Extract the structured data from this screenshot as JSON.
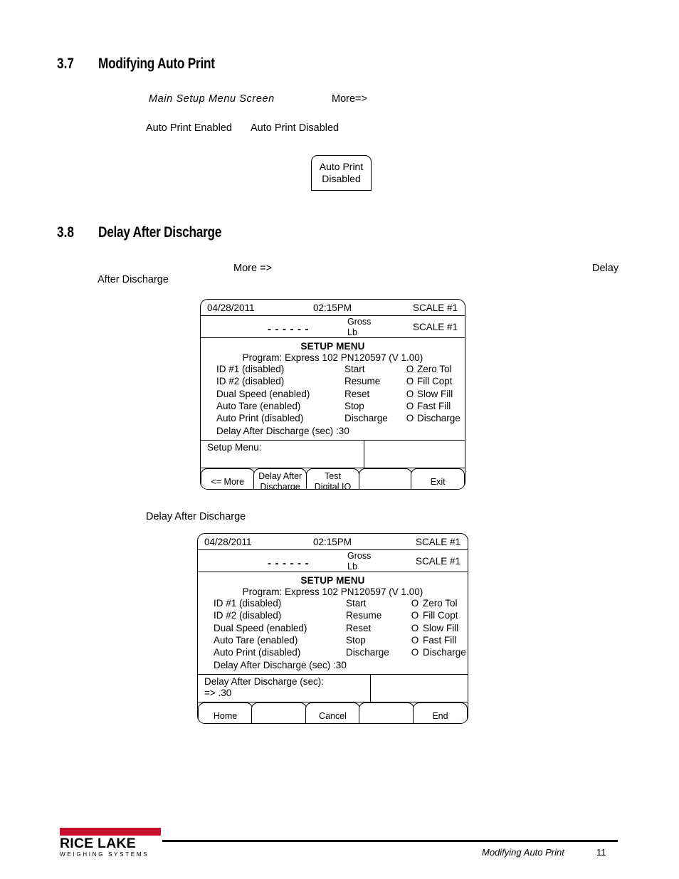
{
  "page": {
    "sections": [
      {
        "number": "3.7",
        "title": "Modifying Auto Print"
      },
      {
        "number": "3.8",
        "title": "Delay After Discharge"
      }
    ]
  },
  "section37": {
    "line1_italic": "Main Setup Menu Screen",
    "line1_more": "More=>",
    "line2_enabled": "Auto Print Enabled",
    "line2_disabled": "Auto Print Disabled",
    "callout": {
      "line1": "Auto Print",
      "line2": "Disabled"
    }
  },
  "section38": {
    "more": "More =>",
    "delay": "Delay",
    "after_discharge": "After Discharge",
    "caption": "Delay After Discharge"
  },
  "panel1": {
    "date": "04/28/2011",
    "time": "02:15PM",
    "scale_top": "SCALE #1",
    "weight_dashes": "------",
    "gross": "Gross",
    "unit": "Lb",
    "scale_weight": "SCALE #1",
    "setup_title": "SETUP MENU",
    "program": "Program: Express 102 PN120597 (V 1.00)",
    "rows": [
      {
        "left": "ID #1 (disabled)",
        "mid": "Start",
        "o": "O",
        "right": "Zero Tol",
        "icon": "bulb-icon"
      },
      {
        "left": "ID #2 (disabled)",
        "mid": "Resume",
        "o": "O",
        "right": "Fill Copt",
        "icon": "bulb-icon"
      },
      {
        "left": "Dual Speed (enabled)",
        "mid": "Reset",
        "o": "O",
        "right": "Slow Fill",
        "icon": "valve-icon"
      },
      {
        "left": "Auto Tare (enabled)",
        "mid": "Stop",
        "o": "O",
        "right": "Fast Fill",
        "icon": "valve-icon"
      },
      {
        "left": "Auto Print (disabled)",
        "mid": "Discharge",
        "o": "O",
        "right": "Discharge",
        "icon": "valve-icon"
      }
    ],
    "last_line": "Delay After Discharge (sec) :30",
    "prompt_line1": "Setup Menu:",
    "prompt_line2": "",
    "softkeys": [
      {
        "line1": "<= More",
        "line2": ""
      },
      {
        "line1": "Delay After",
        "line2": "Discharge"
      },
      {
        "line1": "Test",
        "line2": "Digital IO"
      },
      {
        "line1": "",
        "line2": ""
      },
      {
        "line1": "Exit",
        "line2": ""
      }
    ]
  },
  "panel2": {
    "date": "04/28/2011",
    "time": "02:15PM",
    "scale_top": "SCALE #1",
    "weight_dashes": "------",
    "gross": "Gross",
    "unit": "Lb",
    "scale_weight": "SCALE #1",
    "setup_title": "SETUP MENU",
    "program": "Program: Express 102 PN120597 (V 1.00)",
    "rows": [
      {
        "left": "ID #1 (disabled)",
        "mid": "Start",
        "o": "O",
        "right": "Zero Tol",
        "icon": "bulb-icon"
      },
      {
        "left": "ID #2 (disabled)",
        "mid": "Resume",
        "o": "O",
        "right": "Fill Copt",
        "icon": "bulb-icon"
      },
      {
        "left": "Dual Speed (enabled)",
        "mid": "Reset",
        "o": "O",
        "right": "Slow Fill",
        "icon": "valve-icon"
      },
      {
        "left": "Auto Tare (enabled)",
        "mid": "Stop",
        "o": "O",
        "right": "Fast Fill",
        "icon": "valve-icon"
      },
      {
        "left": "Auto Print (disabled)",
        "mid": "Discharge",
        "o": "O",
        "right": "Discharge",
        "icon": "valve-icon"
      }
    ],
    "last_line": "Delay After Discharge (sec) :30",
    "prompt_line1": "Delay After Discharge (sec):",
    "prompt_line2": "=> .30",
    "softkeys": [
      {
        "line1": "Home",
        "line2": ""
      },
      {
        "line1": "",
        "line2": ""
      },
      {
        "line1": "Cancel",
        "line2": ""
      },
      {
        "line1": "",
        "line2": ""
      },
      {
        "line1": "End",
        "line2": ""
      }
    ]
  },
  "footer": {
    "logo_name": "RICE LAKE",
    "logo_sub": "WEIGHING SYSTEMS",
    "logo_color": "#c8102e",
    "doc_title": "Modifying Auto Print",
    "page_number": "11"
  }
}
